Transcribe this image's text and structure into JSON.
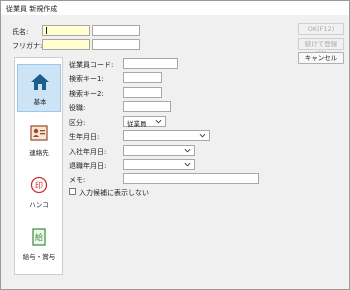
{
  "window": {
    "title": "従業員 新規作成"
  },
  "header_fields": {
    "name_label": "氏名:",
    "furigana_label": "フリガナ:"
  },
  "buttons": {
    "ok": "OK(F12)",
    "continue_register": "続けて登録(F7)",
    "cancel": "キャンセル"
  },
  "sidebar": {
    "items": [
      {
        "label": "基本",
        "icon": "home-icon",
        "active": true
      },
      {
        "label": "連絡先",
        "icon": "contact-card-icon",
        "active": false
      },
      {
        "label": "ハンコ",
        "icon": "seal-stamp-icon",
        "active": false
      },
      {
        "label": "給与・賞与",
        "icon": "salary-document-icon",
        "active": false
      }
    ]
  },
  "form": {
    "employee_code_label": "従業員コード:",
    "search_key1_label": "検索キー1:",
    "search_key2_label": "検索キー2:",
    "position_label": "役職:",
    "category_label": "区分:",
    "category_value": "従業員",
    "birthdate_label": "生年月日:",
    "hire_date_label": "入社年月日:",
    "retire_date_label": "退職年月日:",
    "memo_label": "メモ:",
    "show_in_candidates_label": "入力候補に表示しない"
  },
  "colors": {
    "active_nav": "#cde4f7",
    "name_field_bg": "#ffffd0",
    "home_icon": "#1f5f8f",
    "seal_icon": "#d03030",
    "doc_icon": "#3a8a3a"
  }
}
